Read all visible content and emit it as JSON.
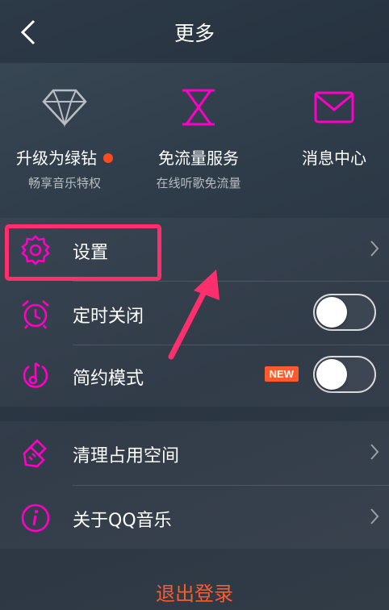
{
  "header": {
    "title": "更多"
  },
  "features": [
    {
      "label": "升级为绿钻",
      "sub": "畅享音乐特权",
      "icon": "diamond-icon"
    },
    {
      "label": "免流量服务",
      "sub": "在线听歌免流量",
      "icon": "hourglass-icon"
    },
    {
      "label": "消息中心",
      "sub": "",
      "icon": "mail-icon"
    }
  ],
  "settings": {
    "label": "设置",
    "icon": "gear-icon"
  },
  "timer": {
    "label": "定时关闭",
    "icon": "alarm-clock-icon",
    "on": false
  },
  "simple": {
    "label": "简约模式",
    "icon": "music-note-icon",
    "badge": "NEW",
    "on": false
  },
  "clean": {
    "label": "清理占用空间",
    "icon": "brush-icon"
  },
  "about": {
    "label": "关于QQ音乐",
    "icon": "info-icon"
  },
  "logout": {
    "label": "退出登录"
  },
  "colors": {
    "accent": "#ff00c8",
    "logout": "#ff5a2b",
    "highlight": "#ff2f6e"
  }
}
